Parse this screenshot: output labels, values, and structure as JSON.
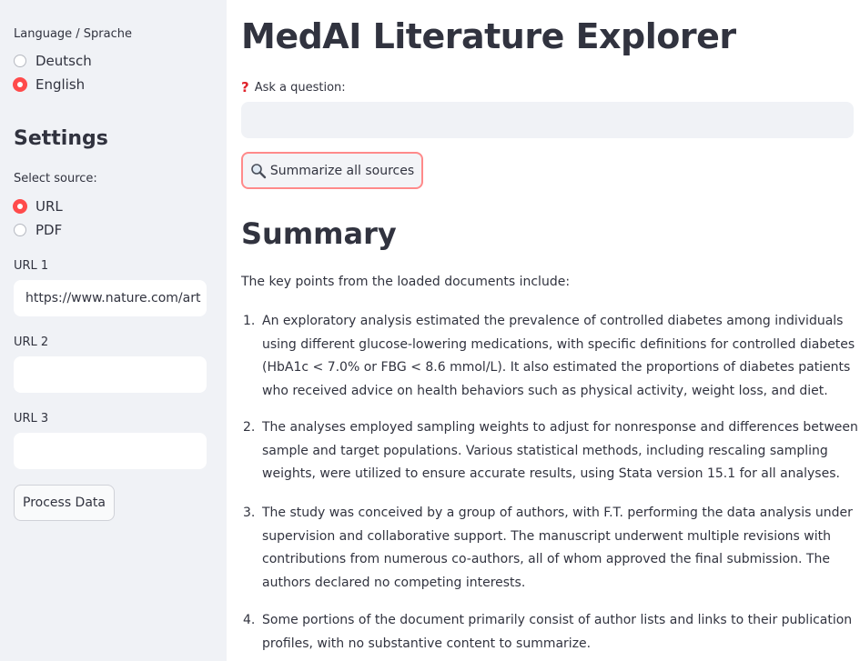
{
  "sidebar": {
    "language_label": "Language / Sprache",
    "languages": [
      {
        "label": "Deutsch",
        "selected": false
      },
      {
        "label": "English",
        "selected": true
      }
    ],
    "settings_heading": "Settings",
    "source_label": "Select source:",
    "sources": [
      {
        "label": "URL",
        "selected": true
      },
      {
        "label": "PDF",
        "selected": false
      }
    ],
    "urls": [
      {
        "label": "URL 1",
        "value": "https://www.nature.com/art"
      },
      {
        "label": "URL 2",
        "value": ""
      },
      {
        "label": "URL 3",
        "value": ""
      }
    ],
    "process_button": "Process Data"
  },
  "main": {
    "title": "MedAI Literature Explorer",
    "question_icon": "question-mark-icon",
    "question_label": "Ask a question:",
    "question_value": "",
    "summarize_icon": "magnifier-icon",
    "summarize_button": "Summarize all sources",
    "summary_heading": "Summary",
    "summary_intro": "The key points from the loaded documents include:",
    "summary_items": [
      {
        "num": "1.",
        "text": "An exploratory analysis estimated the prevalence of controlled diabetes among individuals using different glucose-lowering medications, with specific definitions for controlled diabetes (HbA1c < 7.0% or FBG < 8.6 mmol/L). It also estimated the proportions of diabetes patients who received advice on health behaviors such as physical activity, weight loss, and diet."
      },
      {
        "num": "2.",
        "text": "The analyses employed sampling weights to adjust for nonresponse and differences between sample and target populations. Various statistical methods, including rescaling sampling weights, were utilized to ensure accurate results, using Stata version 15.1 for all analyses."
      },
      {
        "num": "3.",
        "text": "The study was conceived by a group of authors, with F.T. performing the data analysis under supervision and collaborative support. The manuscript underwent multiple revisions with contributions from numerous co-authors, all of whom approved the final submission. The authors declared no competing interests."
      },
      {
        "num": "4.",
        "text": "Some portions of the document primarily consist of author lists and links to their publication profiles, with no substantive content to summarize."
      }
    ]
  },
  "colors": {
    "accent": "#ff4b4b",
    "sidebar_bg": "#f0f2f6",
    "text": "#31333f"
  }
}
